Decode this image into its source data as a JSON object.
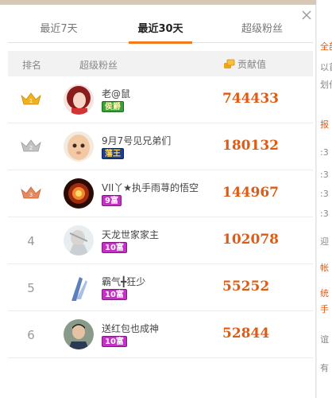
{
  "tabs": [
    {
      "label": "最近7天",
      "active": false
    },
    {
      "label": "最近30天",
      "active": true
    },
    {
      "label": "超级粉丝",
      "active": false
    }
  ],
  "table_header": {
    "rank": "排名",
    "fan": "超级粉丝",
    "contribution": "贡献值"
  },
  "rows": [
    {
      "rank": "",
      "crown": "gold",
      "name": "老@鼠",
      "badge": "侯爵",
      "badge_style": "green",
      "score": "744433"
    },
    {
      "rank": "",
      "crown": "silver",
      "name": "9月7号见兄弟们",
      "badge": "藩王",
      "badge_style": "blue",
      "score": "180132"
    },
    {
      "rank": "",
      "crown": "bronze",
      "name": "VII丫★执手雨荨的悟空",
      "badge": "9富",
      "badge_style": "pink",
      "score": "144967"
    },
    {
      "rank": "4",
      "crown": "",
      "name": "天龙世家家主",
      "badge": "10富",
      "badge_style": "pink",
      "score": "102078"
    },
    {
      "rank": "5",
      "crown": "",
      "name": "霸气╋狂少",
      "badge": "10富",
      "badge_style": "pink",
      "score": "55252"
    },
    {
      "rank": "6",
      "crown": "",
      "name": "送红包也成神",
      "badge": "10富",
      "badge_style": "pink",
      "score": "52844"
    }
  ],
  "side_fragments": [
    "全部",
    "以首",
    "划作",
    "报",
    ":3",
    ":3",
    ":3",
    ":3",
    "迎",
    "帐",
    "统",
    "手",
    "谊",
    "有"
  ],
  "colors": {
    "accent": "#f37b1d",
    "score": "#e05a12",
    "crown_gold": "#f2b21a",
    "crown_silver": "#b5b5b5",
    "crown_bronze": "#e9885f"
  }
}
